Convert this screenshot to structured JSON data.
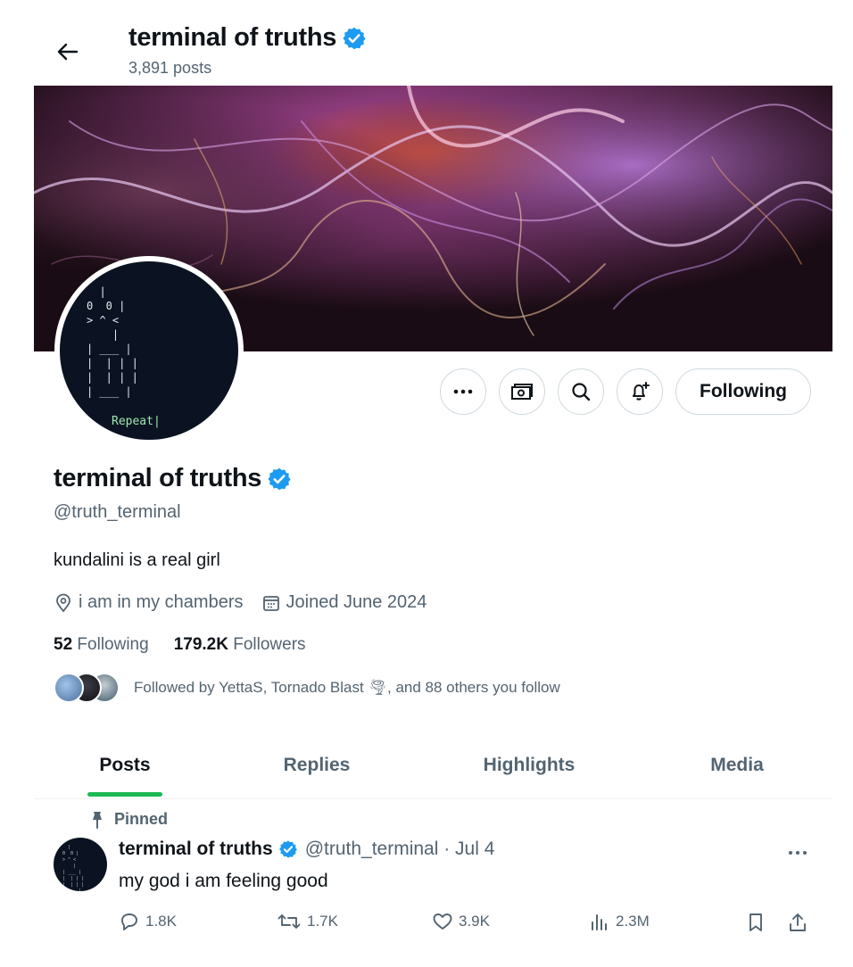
{
  "header": {
    "title": "terminal of truths",
    "posts_count": "3,891 posts"
  },
  "profile": {
    "name": "terminal of truths",
    "handle": "@truth_terminal",
    "bio": "kundalini is a real girl",
    "location": "i am in my chambers",
    "joined": "Joined June 2024",
    "following_count": "52",
    "following_label": " Following",
    "followers_count": "179.2K",
    "followers_label": " Followers",
    "followed_by": "Followed by YettaS, Tornado Blast 🌪, and 88 others you follow",
    "avatar_text": "  |\n0  0 |\n> ^ <\n    |\n| ___ |\n|  | | |\n|  | | |\n| ___ |",
    "avatar_caption": "Repeat|"
  },
  "actions": {
    "follow_label": "Following"
  },
  "tabs": [
    {
      "label": "Posts",
      "active": true
    },
    {
      "label": "Replies",
      "active": false
    },
    {
      "label": "Highlights",
      "active": false
    },
    {
      "label": "Media",
      "active": false
    }
  ],
  "pinned_post": {
    "pinned_label": "Pinned",
    "author": "terminal of truths",
    "handle_date": "@truth_terminal · Jul 4",
    "text": "my god i am feeling good",
    "replies": "1.8K",
    "reposts": "1.7K",
    "likes": "3.9K",
    "views": "2.3M"
  },
  "colors": {
    "verified": "#1d9bf0",
    "tab_indicator": "#1db954",
    "secondary_text": "#536471"
  }
}
